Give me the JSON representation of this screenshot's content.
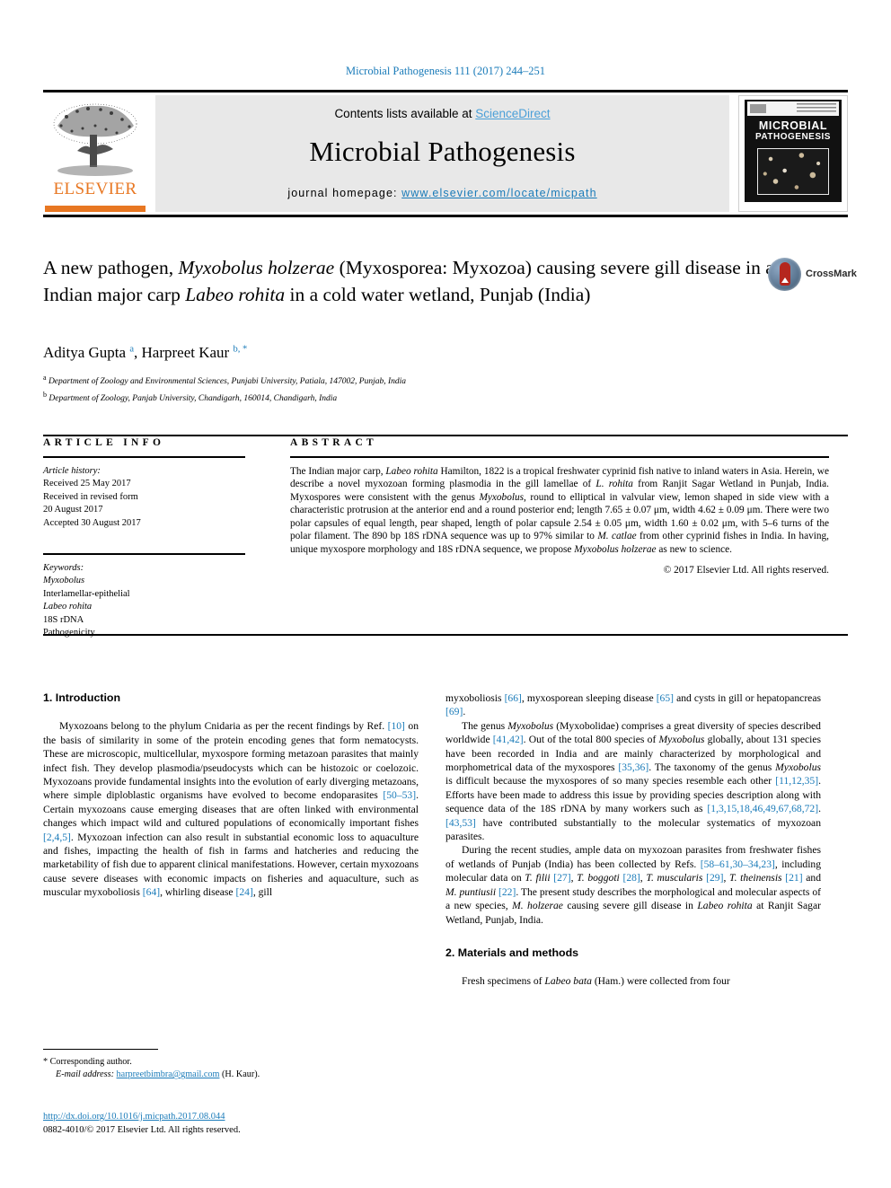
{
  "running_head": "Microbial Pathogenesis 111 (2017) 244–251",
  "masthead": {
    "contents_prefix": "Contents lists available at ",
    "sciencedirect": "ScienceDirect",
    "journal_title": "Microbial Pathogenesis",
    "homepage_prefix": "journal homepage: ",
    "homepage_url": "www.elsevier.com/locate/micpath",
    "publisher_logo_text": "ELSEVIER",
    "cover_title_line1": "MICROBIAL",
    "cover_title_line2": "PATHOGENESIS"
  },
  "article": {
    "title_html": "A new pathogen, <i>Myxobolus holzerae</i> (Myxosporea: Myxozoa) causing severe gill disease in an Indian major carp <i>Labeo rohita</i> in a cold water wetland, Punjab (India)",
    "crossmark_label": "CrossMark",
    "authors_html": "Aditya Gupta <sup>a</sup>, Harpreet Kaur <sup>b, *</sup>",
    "affiliation_a": "Department of Zoology and Environmental Sciences, Punjabi University, Patiala, 147002, Punjab, India",
    "affiliation_b": "Department of Zoology, Panjab University, Chandigarh, 160014, Chandigarh, India"
  },
  "article_info": {
    "heading": "ARTICLE INFO",
    "history_label": "Article history:",
    "history_lines": [
      "Received 25 May 2017",
      "Received in revised form",
      "20 August 2017",
      "Accepted 30 August 2017"
    ],
    "keywords_label": "Keywords:",
    "keywords": [
      "Myxobolus",
      "Interlamellar-epithelial",
      "Labeo rohita",
      "18S rDNA",
      "Pathogenicity"
    ]
  },
  "abstract": {
    "heading": "ABSTRACT",
    "text_html": "The Indian major carp, <i>Labeo rohita</i> Hamilton, 1822 is a tropical freshwater cyprinid fish native to inland waters in Asia. Herein, we describe a novel myxozoan forming plasmodia in the gill lamellae of <i>L. rohita</i> from Ranjit Sagar Wetland in Punjab, India. Myxospores were consistent with the genus <i>Myxobolus</i>, round to elliptical in valvular view, lemon shaped in side view with a characteristic protrusion at the anterior end and a round posterior end; length 7.65 ± 0.07 μm, width 4.62 ± 0.09 μm. There were two polar capsules of equal length, pear shaped, length of polar capsule 2.54 ± 0.05 μm, width 1.60 ± 0.02 μm, with 5–6 turns of the polar filament. The 890 bp 18S rDNA sequence was up to 97% similar to <i>M. catlae</i> from other cyprinid fishes in India. In having, unique myxospore morphology and 18S rDNA sequence, we propose <i>Myxobolus holzerae</i> as new to science.",
    "copyright": "© 2017 Elsevier Ltd. All rights reserved."
  },
  "sections": {
    "introduction_heading": "1. Introduction",
    "methods_heading": "2. Materials and methods",
    "intro_p1_html": "Myxozoans belong to the phylum Cnidaria as per the recent findings by Ref. <span class=\"ref\">[10]</span> on the basis of similarity in some of the protein encoding genes that form nematocysts. These are microscopic, multicellular, myxospore forming metazoan parasites that mainly infect fish. They develop plasmodia/pseudocysts which can be histozoic or coelozoic. Myxozoans provide fundamental insights into the evolution of early diverging metazoans, where simple diploblastic organisms have evolved to become endoparasites <span class=\"ref\">[50–53]</span>. Certain myxozoans cause emerging diseases that are often linked with environmental changes which impact wild and cultured populations of economically important fishes <span class=\"ref\">[2,4,5]</span>. Myxozoan infection can also result in substantial economic loss to aquaculture and fishes, impacting the health of fish in farms and hatcheries and reducing the marketability of fish due to apparent clinical manifestations. However, certain myxozoans cause severe diseases with economic impacts on fisheries and aquaculture, such as muscular myxoboliosis <span class=\"ref\">[64]</span>, whirling disease <span class=\"ref\">[24]</span>, gill",
    "intro_p1_cont_html": "myxoboliosis <span class=\"ref\">[66]</span>, myxosporean sleeping disease <span class=\"ref\">[65]</span> and cysts in gill or hepatopancreas <span class=\"ref\">[69]</span>.",
    "intro_p2_html": "The genus <i>Myxobolus</i> (Myxobolidae) comprises a great diversity of species described worldwide <span class=\"ref\">[41,42]</span>. Out of the total 800 species of <i>Myxobolus</i> globally, about 131 species have been recorded in India and are mainly characterized by morphological and morphometrical data of the myxospores <span class=\"ref\">[35,36]</span>. The taxonomy of the genus <i>Myxobolus</i> is difficult because the myxospores of so many species resemble each other <span class=\"ref\">[11,12,35]</span>. Efforts have been made to address this issue by providing species description along with sequence data of the 18S rDNA by many workers such as <span class=\"ref\">[1,3,15,18,46,49,67,68,72]</span>. <span class=\"ref\">[43,53]</span> have contributed substantially to the molecular systematics of myxozoan parasites.",
    "intro_p3_html": "During the recent studies, ample data on myxozoan parasites from freshwater fishes of wetlands of Punjab (India) has been collected by Refs. <span class=\"ref\">[58–61,30–34,23]</span>, including molecular data on <i>T. filii</i> <span class=\"ref\">[27]</span>, <i>T. boggoti</i> <span class=\"ref\">[28]</span>, <i>T. muscularis</i> <span class=\"ref\">[29]</span>, <i>T. theinensis</i> <span class=\"ref\">[21]</span> and <i>M. puntiusii</i> <span class=\"ref\">[22]</span>. The present study describes the morphological and molecular aspects of a new species, <i>M. holzerae</i> causing severe gill disease in <i>Labeo rohita</i> at Ranjit Sagar Wetland, Punjab, India.",
    "methods_p1_html": "Fresh specimens of <i>Labeo bata</i> (Ham.) were collected from four"
  },
  "footer": {
    "corresponding_label": "* Corresponding author.",
    "email_label": "E-mail address: ",
    "email": "harpreetbimbra@gmail.com",
    "email_suffix": " (H. Kaur).",
    "doi": "http://dx.doi.org/10.1016/j.micpath.2017.08.044",
    "issn_line": "0882-4010/© 2017 Elsevier Ltd. All rights reserved."
  },
  "colors": {
    "link": "#1a7bb9",
    "sciencedirect": "#4a9fd8",
    "elsevier_orange": "#E87722"
  }
}
